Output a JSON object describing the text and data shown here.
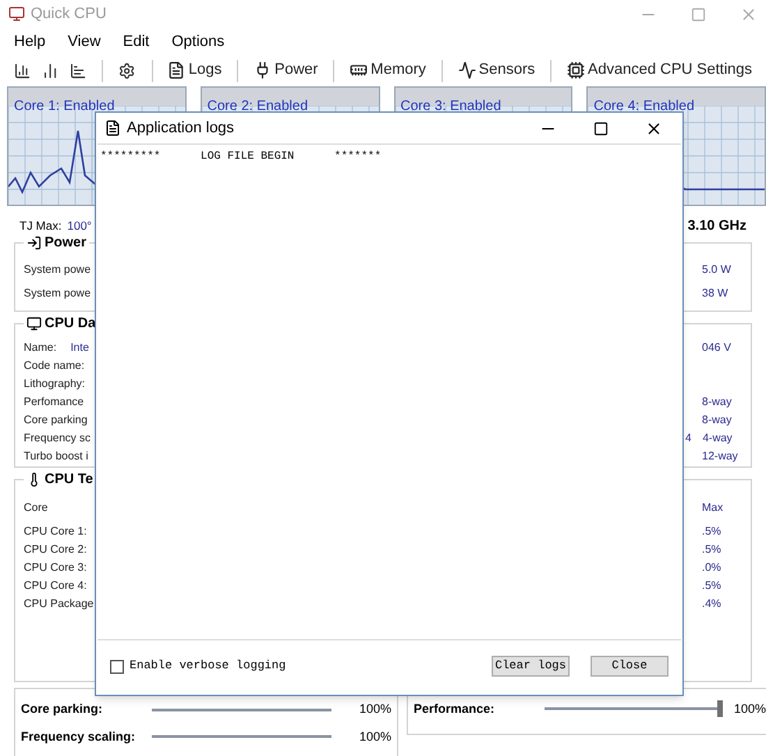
{
  "window": {
    "title": "Quick CPU"
  },
  "menu": [
    "Help",
    "View",
    "Edit",
    "Options"
  ],
  "toolbar": [
    {
      "kind": "chart-a"
    },
    {
      "kind": "chart-b"
    },
    {
      "kind": "chart-c"
    },
    {
      "kind": "gear"
    },
    {
      "kind": "logs",
      "label": "Logs"
    },
    {
      "kind": "power",
      "label": "Power"
    },
    {
      "kind": "memory",
      "label": "Memory"
    },
    {
      "kind": "sensors",
      "label": "Sensors"
    },
    {
      "kind": "chip",
      "label": "Advanced CPU Settings"
    }
  ],
  "cores": [
    {
      "label": "Core 1: Enabled"
    },
    {
      "label": "Core 2: Enabled"
    },
    {
      "label": "Core 3: Enabled"
    },
    {
      "label": "Core 4: Enabled"
    }
  ],
  "tj_max": {
    "label": "TJ Max:",
    "value": "100°",
    "frequency": "3.10 GHz"
  },
  "power": {
    "title": "Power",
    "rows": [
      {
        "label": "System powe",
        "right": "5.0 W"
      },
      {
        "label": "System powe",
        "right": "38 W"
      }
    ]
  },
  "cpu_data": {
    "title": "CPU Da",
    "rows": [
      {
        "label": "Name:",
        "value": "Inte",
        "right": "046 V"
      },
      {
        "label": "Code name:"
      },
      {
        "label": "Lithography:"
      },
      {
        "label": "Perfomance",
        "right": "8-way"
      },
      {
        "label": "Core parking",
        "right": "8-way"
      },
      {
        "label": "Frequency sc",
        "mid": "4",
        "right": "4-way"
      },
      {
        "label": "Turbo boost i",
        "right": "12-way"
      }
    ]
  },
  "cpu_temp": {
    "title": "CPU Te",
    "header": {
      "label": "Core",
      "right": "Max"
    },
    "rows": [
      {
        "label": "CPU Core 1:",
        "right": ".5%"
      },
      {
        "label": "CPU Core 2:",
        "right": ".5%"
      },
      {
        "label": "CPU Core 3:",
        "right": ".0%"
      },
      {
        "label": "CPU Core 4:",
        "right": ".5%"
      },
      {
        "label": "CPU Package",
        "right": ".4%"
      }
    ]
  },
  "bottom_left": [
    {
      "label": "Core parking:",
      "value": "100%"
    },
    {
      "label": "Frequency scaling:",
      "value": "100%"
    }
  ],
  "bottom_right": {
    "label": "Performance:",
    "value": "100%",
    "level": 1
  },
  "dialog": {
    "title": "Application logs",
    "log": "*********      LOG FILE BEGIN      *******",
    "verbose": {
      "label": "Enable verbose logging",
      "checked": false
    },
    "buttons": [
      "Clear logs",
      "Close"
    ]
  }
}
